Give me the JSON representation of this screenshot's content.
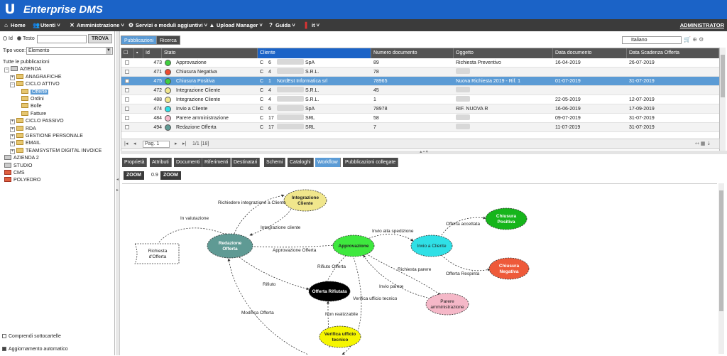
{
  "app": {
    "logo": "U",
    "title": "Enterprise DMS"
  },
  "menu": {
    "items": [
      {
        "icon": "home-icon",
        "glyph": "⌂",
        "label": "Home"
      },
      {
        "icon": "users-icon",
        "glyph": "👥",
        "label": "Utenti ˅"
      },
      {
        "icon": "tools-icon",
        "glyph": "✕",
        "label": "Amministrazione ˅"
      },
      {
        "icon": "gear-icon",
        "glyph": "⚙",
        "label": "Servizi e moduli aggiuntivi ˅"
      },
      {
        "icon": "upload-icon",
        "glyph": "▲",
        "label": "Upload Manager ˅"
      },
      {
        "icon": "help-icon",
        "glyph": "?",
        "label": "Guida ˅"
      },
      {
        "icon": "flag-icon",
        "glyph": "▌",
        "label": "it ˅"
      }
    ],
    "admin": "ADMINISTRATOR"
  },
  "search": {
    "option_id": "Id",
    "option_text": "Testo",
    "input_value": "",
    "button": "TROVA",
    "tipovoce_label": "Tipo voce:",
    "tipovoce_value": "Elemento"
  },
  "tree": [
    {
      "label": "Tutte le pubblicazioni",
      "exp": "",
      "folder": ""
    },
    {
      "label": "AZIENDA",
      "exp": "⊟",
      "folder": "drw"
    },
    {
      "label": "ANAGRAFICHE",
      "exp": "⊞",
      "folder": "fld"
    },
    {
      "label": "CICLO ATTIVO",
      "exp": "⊟",
      "folder": "fld"
    },
    {
      "label": "Offerte",
      "exp": "",
      "folder": "fld",
      "selected": true
    },
    {
      "label": "Ordini",
      "exp": "",
      "folder": "fld"
    },
    {
      "label": "Bolle",
      "exp": "",
      "folder": "fld"
    },
    {
      "label": "Fatture",
      "exp": "",
      "folder": "fld"
    },
    {
      "label": "CICLO PASSIVO",
      "exp": "⊞",
      "folder": "fld"
    },
    {
      "label": "RDA",
      "exp": "⊞",
      "folder": "fld"
    },
    {
      "label": "GESTIONE PERSONALE",
      "exp": "⊞",
      "folder": "fld"
    },
    {
      "label": "EMAIL",
      "exp": "⊞",
      "folder": "fld"
    },
    {
      "label": "TEAMSYSTEM DIGITAL INVOICE",
      "exp": "⊞",
      "folder": "fld"
    },
    {
      "label": "AZIENDA 2",
      "exp": "",
      "folder": "drw"
    },
    {
      "label": "STUDIO",
      "exp": "",
      "folder": "drw"
    },
    {
      "label": "CMS",
      "exp": "",
      "folder": "red"
    },
    {
      "label": "POLYEDRO",
      "exp": "",
      "folder": "red"
    }
  ],
  "options": {
    "subfolders": "Comprendi sottocartelle",
    "auto_update": "Aggiornamento automatico"
  },
  "tabs": {
    "pubblicazioni": "Pubblicazioni",
    "ricerca": "Ricerca"
  },
  "language": "Italiano",
  "grid": {
    "headers": [
      "Id",
      "Stato",
      "Cliente",
      "Numero documento",
      "Oggetto",
      "Data documento",
      "Data Scadenza Offerta"
    ],
    "rows": [
      {
        "id": "473",
        "color": "#3fcf3f",
        "stato": "Approvazione",
        "c": "C",
        "n": "6",
        "cliente_suffix": "SpA",
        "numero": "89",
        "oggetto": "Richiesta Preventivo",
        "data": "16-04-2019",
        "scadenza": "26-07-2019"
      },
      {
        "id": "471",
        "color": "#ee4a30",
        "stato": "Chiusura Negativa",
        "c": "C",
        "n": "4",
        "cliente_suffix": "S.R.L.",
        "numero": "78",
        "oggetto": "",
        "data": "",
        "scadenza": ""
      },
      {
        "id": "475",
        "color": "#3fcf3f",
        "stato": "Chiusura Positiva",
        "c": "C",
        "n": "1",
        "cliente_suffix": "NordEst Informatica srl",
        "numero": "78965",
        "oggetto": "Nuova Richiesta 2019 - Rif. 1",
        "data": "01-07-2019",
        "scadenza": "31-07-2019"
      },
      {
        "id": "472",
        "color": "#f0e68c",
        "stato": "Integrazione Cliente",
        "c": "C",
        "n": "4",
        "cliente_suffix": "S.R.L.",
        "numero": "45",
        "oggetto": "",
        "data": "",
        "scadenza": ""
      },
      {
        "id": "488",
        "color": "#f0e68c",
        "stato": "Integrazione Cliente",
        "c": "C",
        "n": "4",
        "cliente_suffix": "S.R.L.",
        "numero": "1",
        "oggetto": "",
        "data": "22-05-2019",
        "scadenza": "12-07-2019"
      },
      {
        "id": "474",
        "color": "#2fe0e6",
        "stato": "Invio a Cliente",
        "c": "C",
        "n": "6",
        "cliente_suffix": "SpA",
        "numero": "78978",
        "oggetto": "RIF. NUOVA R",
        "data": "16-06-2019",
        "scadenza": "17-09-2019"
      },
      {
        "id": "484",
        "color": "#f5b8c8",
        "stato": "Parere amministrazione",
        "c": "C",
        "n": "17",
        "cliente_suffix": "SRL",
        "numero": "58",
        "oggetto": "",
        "data": "09-07-2019",
        "scadenza": "31-07-2019"
      },
      {
        "id": "494",
        "color": "#5f9a94",
        "stato": "Redazione Offerta",
        "c": "C",
        "n": "17",
        "cliente_suffix": "SRL",
        "numero": "7",
        "oggetto": "",
        "data": "11-07-2019",
        "scadenza": "31-07-2019"
      }
    ],
    "footer": {
      "page_label": "Pag. 1",
      "pages": "1/1 [18]"
    }
  },
  "detail_tabs": [
    "Proprietà",
    "Attributi",
    "Documenti",
    "Riferimenti",
    "Destinatari",
    "Schemi",
    "Cataloghi",
    "Workflow",
    "Pubblicazioni collegate"
  ],
  "zoom": {
    "minus": "ZOOM -",
    "value": "0.9",
    "plus": "ZOOM +"
  },
  "workflow": {
    "nodes": {
      "richiesta": "Richiesta\nd'Offerta",
      "redazione": "Redazione\nOfferta",
      "integrazione": "Integrazione\nCliente",
      "approvazione": "Approvazione",
      "invio": "Invio a Cliente",
      "positiva": "Chiusura\nPositiva",
      "negativa": "Chiusura\nNegativa",
      "rifiutata": "Offerta Rifiutata",
      "parere": "Parere\namministrazione",
      "verifica": "Verifica ufficio\ntecnico"
    },
    "edges": {
      "in_valutazione": "In valutazione",
      "richiedere_integrazione": "Richiedere integrazione a Cliente",
      "integrazione_cliente": "Integrazione cliente",
      "approvazione_offerta": "Approvazione Offerta",
      "invio_spedizione": "Invio alla spedizione",
      "offerta_accettata": "Offerta accettata",
      "offerta_respinta": "Offerta Respinta",
      "rifiuto_offerta": "Rifiuto Offerta",
      "rifiuto": "Rifiuto",
      "richiesta_parere": "Richiesta parere",
      "invio_parere": "Invio parere",
      "verifica_tecnico": "Verifica ufficio tecnico",
      "non_realizzabile": "Non realizzabile",
      "modifica_offerta": "Modifica Offerta"
    }
  }
}
